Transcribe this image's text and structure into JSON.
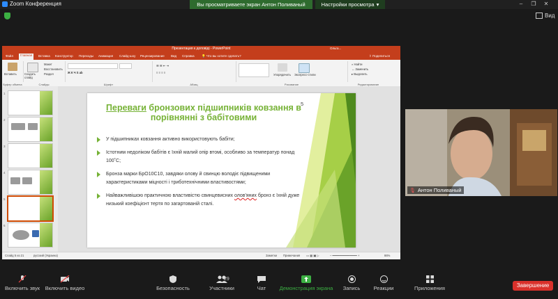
{
  "zoom": {
    "title": "Zoom Конференция",
    "share_banner": "Вы просматриваете экран Антон Поливаный",
    "view_settings": "Настройки просмотра",
    "view_label": "Вид"
  },
  "ppt": {
    "title": "Презентация к доповіді - PowerPoint",
    "user": "Ольга...",
    "tabs": [
      "Файл",
      "Главная",
      "Вставка",
      "Конструктор",
      "Переходы",
      "Анимация",
      "Слайд-шоу",
      "Рецензирование",
      "Вид",
      "Справка",
      "Что вы хотите сделать?"
    ],
    "share": "Поделиться",
    "ribbon_groups": [
      "Буфер обмена",
      "Слайды",
      "Шрифт",
      "Абзац",
      "Рисование",
      "Редактирование"
    ],
    "ribbon_buttons": {
      "paste": "Вставить",
      "new_slide": "Создать слайд",
      "layout": "Макет",
      "reset": "Восстановить",
      "section": "Раздел",
      "arrange": "Упорядочить",
      "quick_styles": "Экспресс-стили",
      "find": "Найти",
      "replace": "Заменить",
      "select": "Выделить"
    },
    "thumb_numbers": [
      "1",
      "2",
      "3",
      "4",
      "5",
      "6"
    ],
    "status": {
      "slide": "Слайд 5 из 21",
      "language": "русский (Украина)",
      "notes": "Заметки",
      "comments": "Примечания",
      "zoom": "86%"
    }
  },
  "slide": {
    "title_underlined": "Переваги",
    "title_rest": " бронзових підшипників ковзання в порівнянні з бабітовими",
    "number": "5",
    "bullets": [
      {
        "text": "У підшипниках ковзання активно використовують бабіти;"
      },
      {
        "text": "Істотним недоліком бабітів є їхній малий опір втомі, особливо за температур понад 100˚С;"
      },
      {
        "text": "Бронза марки БрО10С10, завдяки олову й свинцю володіє підвищеними характеристиками міцності і триботехнічними властивостями;"
      },
      {
        "pre": "Найважливішою практичною властивістю свинцевисних ",
        "wavy": "олов'яних",
        "post": " бронз є їхній дуже низький коефіцієнт тертя по загартованій сталі."
      }
    ]
  },
  "speaker": {
    "name": "Антон Поливаный"
  },
  "toolbar": {
    "unmute": "Включить звук",
    "start_video": "Включить видео",
    "security": "Безопасность",
    "participants": "Участники",
    "participants_count": "29",
    "chat": "Чат",
    "share_screen": "Демонстрация экрана",
    "record": "Запись",
    "reactions": "Реакции",
    "apps": "Приложения",
    "end": "Завершение"
  },
  "colors": {
    "accent_green": "#76b236",
    "ppt_red": "#c43e1c",
    "end_red": "#d9312b",
    "share_green": "#3cb043"
  }
}
